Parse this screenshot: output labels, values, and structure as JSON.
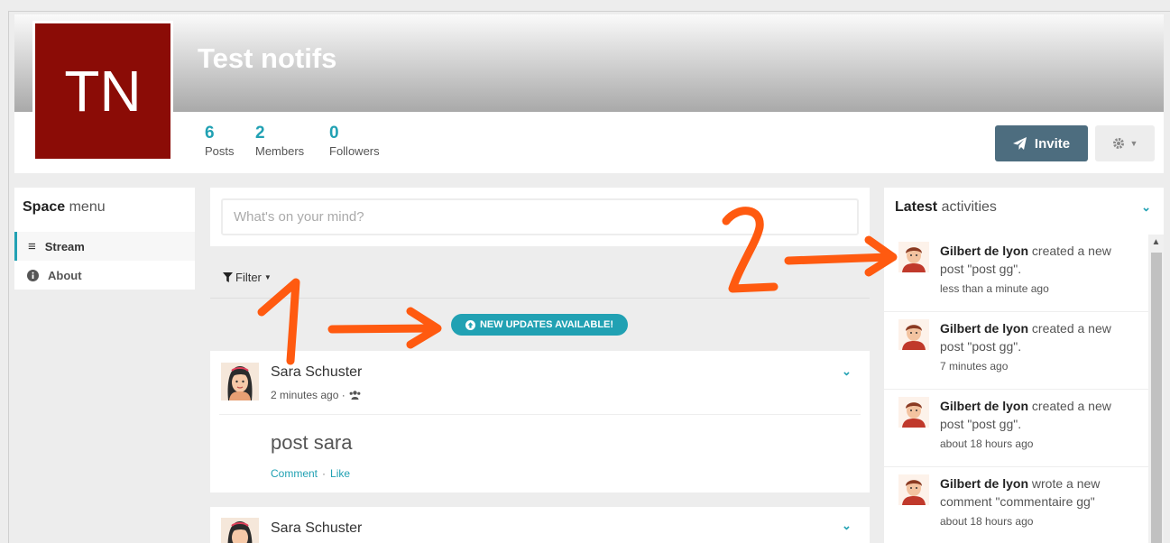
{
  "space": {
    "title": "Test notifs",
    "initials": "TN",
    "stats": [
      {
        "count": "6",
        "label": "Posts"
      },
      {
        "count": "2",
        "label": "Members"
      },
      {
        "count": "0",
        "label": "Followers"
      }
    ],
    "invite_label": "Invite"
  },
  "colors": {
    "accent": "#21a1b3",
    "logo_bg": "#8b0c06",
    "invite_bg": "#4d6d7f",
    "annotation": "#ff5a10"
  },
  "space_menu": {
    "title_bold": "Space",
    "title_rest": " menu",
    "items": [
      {
        "label": "Stream",
        "icon": "bars-icon",
        "active": true
      },
      {
        "label": "About",
        "icon": "info-circle-icon",
        "active": false
      }
    ]
  },
  "composer": {
    "placeholder": "What's on your mind?"
  },
  "filter_label": "Filter",
  "updates_badge": "NEW UPDATES AVAILABLE!",
  "posts": [
    {
      "author": "Sara Schuster",
      "time": "2 minutes ago ·",
      "body": "post sara",
      "comment_label": "Comment",
      "separator": "·",
      "like_label": "Like"
    },
    {
      "author": "Sara Schuster"
    }
  ],
  "activities": {
    "title_bold": "Latest",
    "title_rest": " activities",
    "items": [
      {
        "user": "Gilbert de lyon",
        "text": " created a new post \"post gg\".",
        "time": "less than a minute ago"
      },
      {
        "user": "Gilbert de lyon",
        "text": " created a new post \"post gg\".",
        "time": "7 minutes ago"
      },
      {
        "user": "Gilbert de lyon",
        "text": " created a new post \"post gg\".",
        "time": "about 18 hours ago"
      },
      {
        "user": "Gilbert de lyon",
        "text": " wrote a new comment \"commentaire gg\"",
        "time": "about 18 hours ago"
      }
    ]
  },
  "annotations": {
    "label_1": "1",
    "label_2": "2"
  }
}
